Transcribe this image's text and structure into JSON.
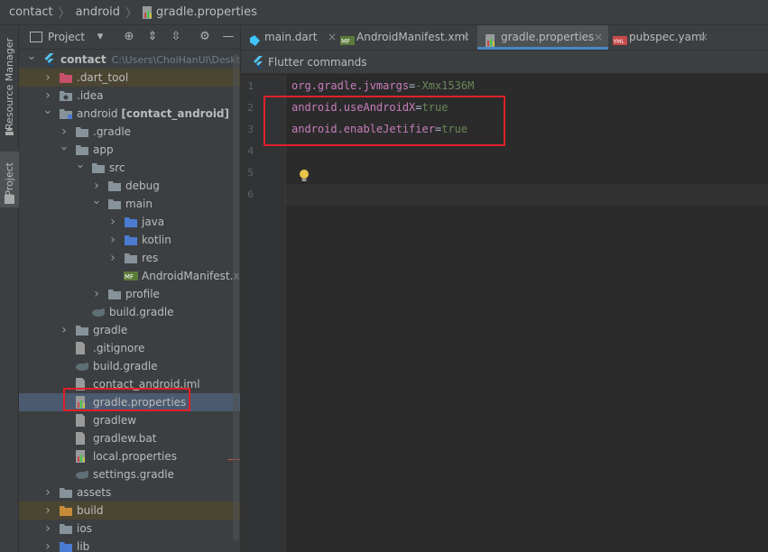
{
  "breadcrumb": {
    "items": [
      "contact",
      "android",
      "gradle.properties"
    ]
  },
  "left_strip": {
    "resource_manager": "Resource Manager",
    "project": "Project"
  },
  "panel": {
    "title": "Project"
  },
  "tree": [
    {
      "label": "contact",
      "extra": "C:\\Users\\ChoiHanUl\\Deskt",
      "indent": 0,
      "arrow": "down",
      "icon": "flutter",
      "bold": true
    },
    {
      "label": ".dart_tool",
      "indent": 1,
      "arrow": "right",
      "icon": "folder-red",
      "hl": true
    },
    {
      "label": ".idea",
      "indent": 1,
      "arrow": "right",
      "icon": "folder-gear"
    },
    {
      "label": "android [contact_android]",
      "indent": 1,
      "arrow": "down",
      "icon": "folder-module",
      "bold_part": "[contact_android]",
      "base": "android "
    },
    {
      "label": ".gradle",
      "indent": 2,
      "arrow": "right",
      "icon": "folder"
    },
    {
      "label": "app",
      "indent": 2,
      "arrow": "down",
      "icon": "folder"
    },
    {
      "label": "src",
      "indent": 3,
      "arrow": "down",
      "icon": "folder"
    },
    {
      "label": "debug",
      "indent": 4,
      "arrow": "right",
      "icon": "folder"
    },
    {
      "label": "main",
      "indent": 4,
      "arrow": "down",
      "icon": "folder"
    },
    {
      "label": "java",
      "indent": 5,
      "arrow": "right",
      "icon": "folder-blue"
    },
    {
      "label": "kotlin",
      "indent": 5,
      "arrow": "right",
      "icon": "folder-blue"
    },
    {
      "label": "res",
      "indent": 5,
      "arrow": "right",
      "icon": "folder"
    },
    {
      "label": "AndroidManifest.xml",
      "indent": 5,
      "arrow": "none",
      "icon": "manifest"
    },
    {
      "label": "profile",
      "indent": 4,
      "arrow": "right",
      "icon": "folder"
    },
    {
      "label": "build.gradle",
      "indent": 3,
      "arrow": "none",
      "icon": "gradle"
    },
    {
      "label": "gradle",
      "indent": 2,
      "arrow": "right",
      "icon": "folder"
    },
    {
      "label": ".gitignore",
      "indent": 2,
      "arrow": "none",
      "icon": "file"
    },
    {
      "label": "build.gradle",
      "indent": 2,
      "arrow": "none",
      "icon": "gradle"
    },
    {
      "label": "contact_android.iml",
      "indent": 2,
      "arrow": "none",
      "icon": "file"
    },
    {
      "label": "gradle.properties",
      "indent": 2,
      "arrow": "none",
      "icon": "properties",
      "selected": true
    },
    {
      "label": "gradlew",
      "indent": 2,
      "arrow": "none",
      "icon": "file"
    },
    {
      "label": "gradlew.bat",
      "indent": 2,
      "arrow": "none",
      "icon": "file"
    },
    {
      "label": "local.properties",
      "indent": 2,
      "arrow": "none",
      "icon": "properties"
    },
    {
      "label": "settings.gradle",
      "indent": 2,
      "arrow": "none",
      "icon": "gradle"
    },
    {
      "label": "assets",
      "indent": 1,
      "arrow": "right",
      "icon": "folder"
    },
    {
      "label": "build",
      "indent": 1,
      "arrow": "right",
      "icon": "folder-orange",
      "hl": true
    },
    {
      "label": "ios",
      "indent": 1,
      "arrow": "right",
      "icon": "folder"
    },
    {
      "label": "lib",
      "indent": 1,
      "arrow": "right",
      "icon": "folder-blue"
    }
  ],
  "tabs": [
    {
      "label": "main.dart",
      "icon": "dart"
    },
    {
      "label": "AndroidManifest.xml",
      "icon": "manifest"
    },
    {
      "label": "gradle.properties",
      "icon": "properties",
      "active": true
    },
    {
      "label": "pubspec.yaml",
      "icon": "yaml"
    }
  ],
  "notice": {
    "text": "Flutter commands"
  },
  "editor": {
    "line_numbers": [
      "1",
      "2",
      "3",
      "4",
      "5",
      "6"
    ],
    "lines": [
      {
        "key": "org.gradle.jvmargs",
        "eq": "=",
        "value": "-Xmx1536M"
      },
      {
        "key": "android.useAndroidX",
        "eq": "=",
        "value": "true"
      },
      {
        "key": "android.enableJetifier",
        "eq": "=",
        "value": "true"
      }
    ]
  },
  "colors": {
    "highlight_box": "#e0202a",
    "accent": "#4a88c7"
  }
}
